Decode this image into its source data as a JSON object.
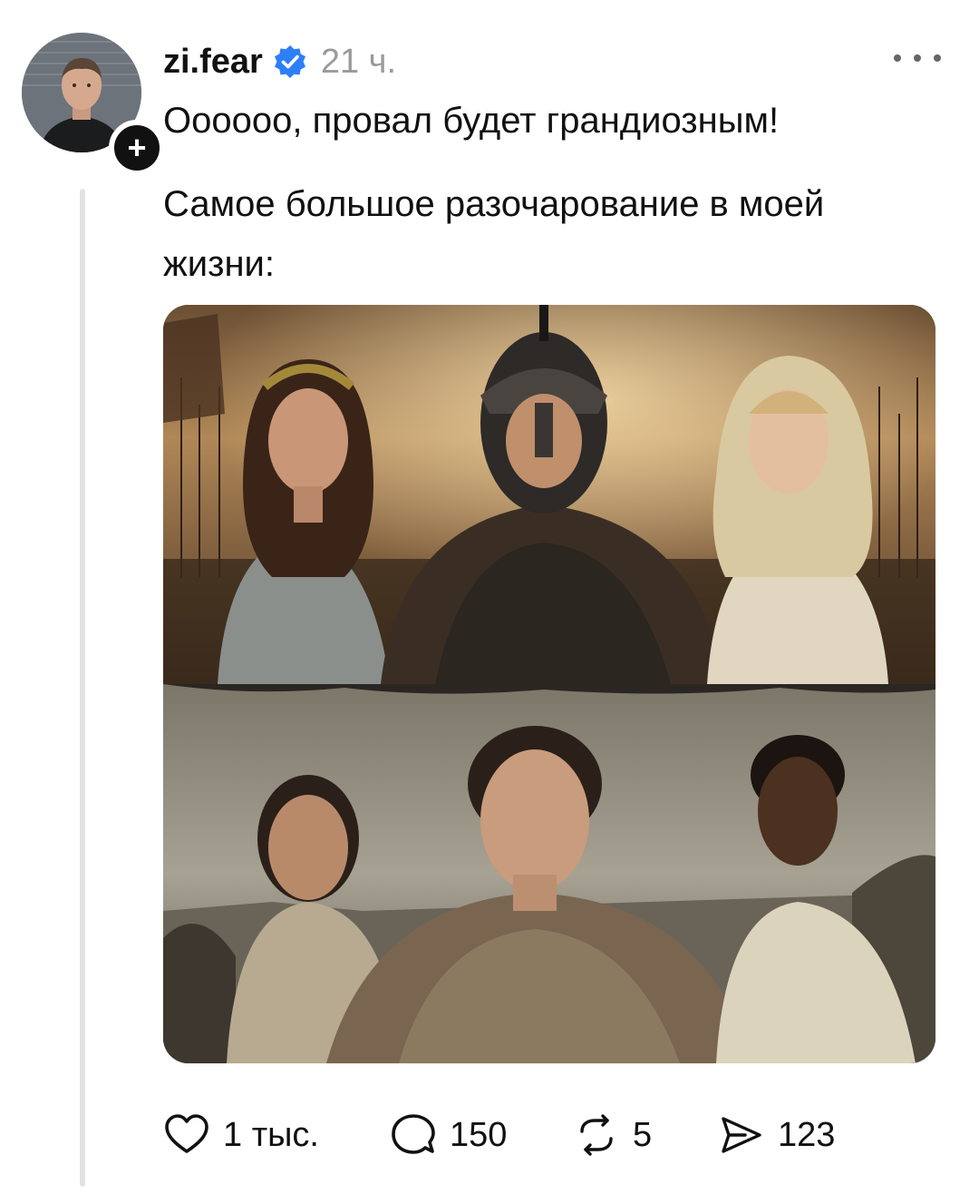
{
  "post": {
    "username": "zi.fear",
    "timestamp": "21 ч.",
    "text_line1": "Оооооо, провал будет грандиозным!",
    "text_line2": "Самое большое разочарование в моей жизни:"
  },
  "avatar": {
    "badge": "+"
  },
  "icons": {
    "verified": "verified-badge-icon",
    "more": "more-options-icon",
    "like": "heart-icon",
    "reply": "comment-bubble-icon",
    "repost": "repost-icon",
    "share": "send-icon"
  },
  "colors": {
    "verified": "#2d7ff9",
    "muted": "#9a9a9a",
    "thread_line": "#e2e2e2"
  },
  "actions": {
    "likes": "1 тыс.",
    "replies": "150",
    "reposts": "5",
    "shares": "123"
  }
}
